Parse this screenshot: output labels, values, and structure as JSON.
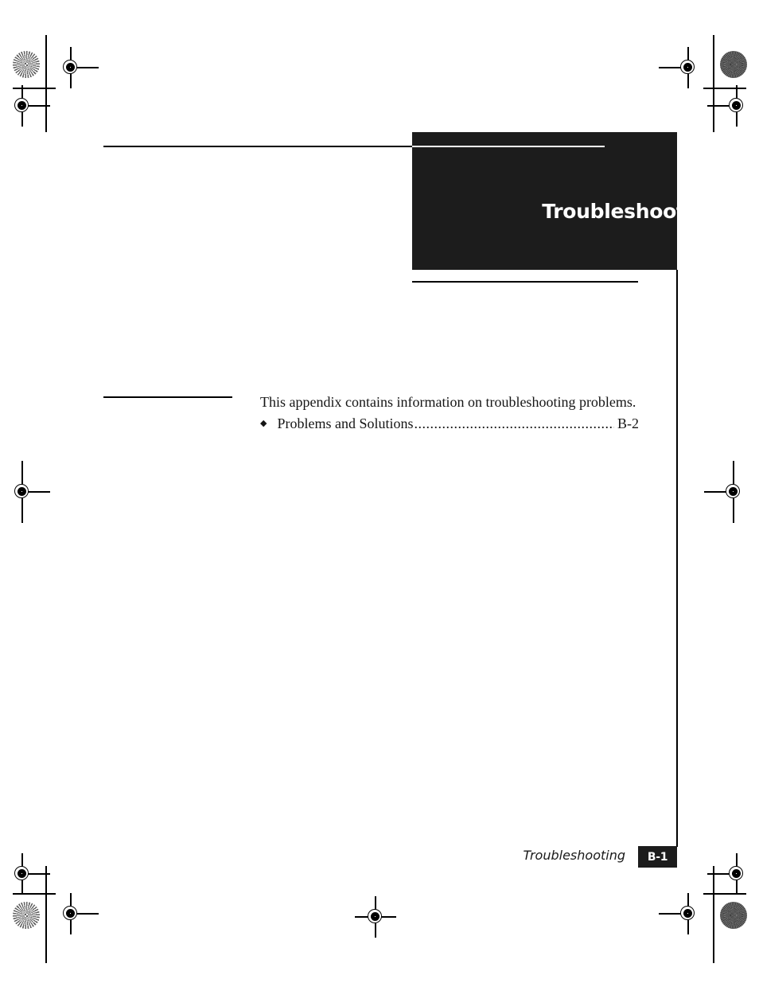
{
  "chapter": {
    "letter": "B",
    "title": "Troubleshooting"
  },
  "body": {
    "intro": "This appendix contains information on troubleshooting problems.",
    "toc": [
      {
        "bullet": "◆",
        "label": "Problems and Solutions",
        "leader": "..............................................................................................",
        "page": "B-2"
      }
    ]
  },
  "footer": {
    "title": "Troubleshooting",
    "page": "B-1"
  },
  "colors": {
    "panel": "#1c1c1c",
    "text": "#151515",
    "page_background": "#ffffff"
  }
}
